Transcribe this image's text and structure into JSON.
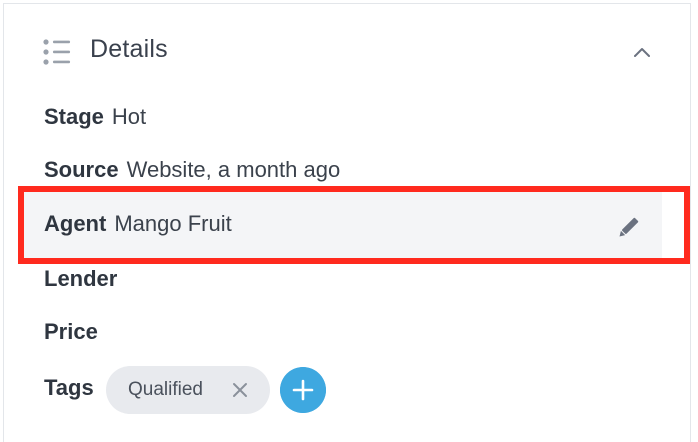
{
  "section": {
    "title": "Details",
    "icon": "list-icon",
    "collapse_icon": "chevron-up-icon"
  },
  "fields": {
    "stage": {
      "label": "Stage",
      "value": "Hot"
    },
    "source": {
      "label": "Source",
      "value": "Website, a month ago"
    },
    "agent": {
      "label": "Agent",
      "value": "Mango Fruit",
      "edit_icon": "pencil-icon"
    },
    "lender": {
      "label": "Lender",
      "value": ""
    },
    "price": {
      "label": "Price",
      "value": ""
    }
  },
  "tags": {
    "label": "Tags",
    "items": [
      {
        "text": "Qualified",
        "remove_icon": "close-icon"
      }
    ],
    "add_icon": "plus-icon"
  },
  "colors": {
    "highlight_border": "#ff2a1e",
    "add_button": "#3ea8e0",
    "tag_chip": "#e8eaee",
    "hover_row": "#f4f5f7"
  }
}
